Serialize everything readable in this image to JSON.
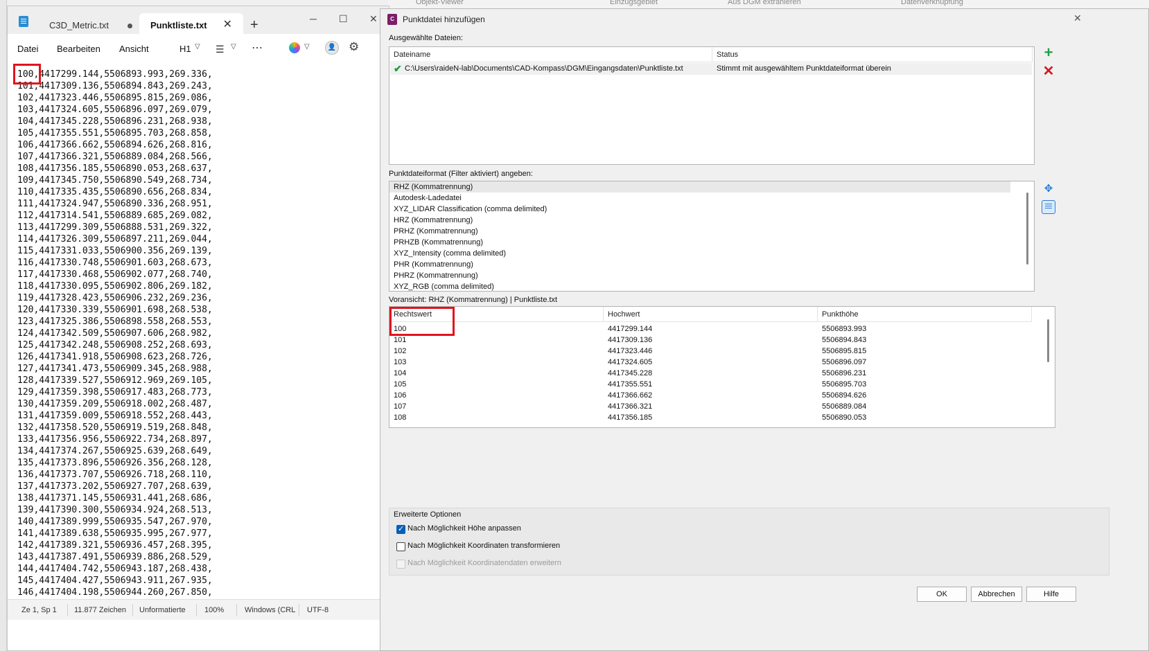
{
  "background_app": {
    "ribbon_fragments": [
      "Objekt-Viewer",
      "Einzugsgebiet",
      "Aus DGM extrahieren",
      "Datenverknüpfung"
    ]
  },
  "notepad": {
    "tabs": [
      {
        "label": "C3D_Metric.txt"
      },
      {
        "label": "Punktliste.txt"
      }
    ],
    "menu": {
      "datei": "Datei",
      "bearbeiten": "Bearbeiten",
      "ansicht": "Ansicht",
      "heading": "H1"
    },
    "lines": [
      "100,4417299.144,5506893.993,269.336,",
      "101,4417309.136,5506894.843,269.243,",
      "102,4417323.446,5506895.815,269.086,",
      "103,4417324.605,5506896.097,269.079,",
      "104,4417345.228,5506896.231,268.938,",
      "105,4417355.551,5506895.703,268.858,",
      "106,4417366.662,5506894.626,268.816,",
      "107,4417366.321,5506889.084,268.566,",
      "108,4417356.185,5506890.053,268.637,",
      "109,4417345.750,5506890.549,268.734,",
      "110,4417335.435,5506890.656,268.834,",
      "111,4417324.947,5506890.336,268.951,",
      "112,4417314.541,5506889.685,269.082,",
      "113,4417299.309,5506888.531,269.322,",
      "114,4417326.309,5506897.211,269.044,",
      "115,4417331.033,5506900.356,269.139,",
      "116,4417330.748,5506901.603,268.673,",
      "117,4417330.468,5506902.077,268.740,",
      "118,4417330.095,5506902.806,269.182,",
      "119,4417328.423,5506906.232,269.236,",
      "120,4417330.339,5506901.698,268.538,",
      "123,4417325.386,5506898.558,268.553,",
      "124,4417342.509,5506907.606,268.982,",
      "125,4417342.248,5506908.252,268.693,",
      "126,4417341.918,5506908.623,268.726,",
      "127,4417341.473,5506909.345,268.988,",
      "128,4417339.527,5506912.969,269.105,",
      "129,4417359.398,5506917.483,268.773,",
      "130,4417359.209,5506918.002,268.487,",
      "131,4417359.009,5506918.552,268.443,",
      "132,4417358.520,5506919.519,268.848,",
      "133,4417356.956,5506922.734,268.897,",
      "134,4417374.267,5506925.639,268.649,",
      "135,4417373.896,5506926.356,268.128,",
      "136,4417373.707,5506926.718,268.110,",
      "137,4417373.202,5506927.707,268.639,",
      "138,4417371.145,5506931.441,268.686,",
      "139,4417390.300,5506934.924,268.513,",
      "140,4417389.999,5506935.547,267.970,",
      "141,4417389.638,5506935.995,267.977,",
      "142,4417389.321,5506936.457,268.395,",
      "143,4417387.491,5506939.886,268.529,",
      "144,4417404.742,5506943.187,268.438,",
      "145,4417404.427,5506943.911,267.935,",
      "146,4417404.198,5506944.260,267.850,"
    ],
    "status": {
      "position": "Ze 1, Sp 1",
      "chars": "11.877 Zeichen",
      "format": "Unformatierte",
      "zoom": "100%",
      "line_ending": "Windows (CRL",
      "encoding": "UTF-8"
    }
  },
  "dialog": {
    "title": "Punktdatei hinzufügen",
    "selected_files_label": "Ausgewählte Dateien:",
    "files_columns": [
      "Dateiname",
      "Status"
    ],
    "files": [
      {
        "name": "C:\\Users\\raideN-lab\\Documents\\CAD-Kompass\\DGM\\Eingangsdaten\\Punktliste.txt",
        "status": "Stimmt mit ausgewähltem Punktdateiformat überein"
      }
    ],
    "format_label": "Punktdateiformat (Filter aktiviert) angeben:",
    "formats": [
      "RHZ (Kommatrennung)",
      "Autodesk-Ladedatei",
      "XYZ_LIDAR Classification (comma delimited)",
      "HRZ (Kommatrennung)",
      "PRHZ (Kommatrennung)",
      "PRHZB (Kommatrennung)",
      "XYZ_Intensity (comma delimited)",
      "PHR (Kommatrennung)",
      "PHRZ (Kommatrennung)",
      "XYZ_RGB (comma delimited)"
    ],
    "preview_label": "Voransicht: RHZ (Kommatrennung) | Punktliste.txt",
    "preview_columns": [
      "Rechtswert",
      "Hochwert",
      "Punkthöhe"
    ],
    "preview_rows": [
      [
        "100",
        "4417299.144",
        "5506893.993"
      ],
      [
        "101",
        "4417309.136",
        "5506894.843"
      ],
      [
        "102",
        "4417323.446",
        "5506895.815"
      ],
      [
        "103",
        "4417324.605",
        "5506896.097"
      ],
      [
        "104",
        "4417345.228",
        "5506896.231"
      ],
      [
        "105",
        "4417355.551",
        "5506895.703"
      ],
      [
        "106",
        "4417366.662",
        "5506894.626"
      ],
      [
        "107",
        "4417366.321",
        "5506889.084"
      ],
      [
        "108",
        "4417356.185",
        "5506890.053"
      ]
    ],
    "options_label": "Erweiterte Optionen",
    "options": [
      {
        "label": "Nach Möglichkeit Höhe anpassen",
        "checked": true,
        "enabled": true
      },
      {
        "label": "Nach Möglichkeit Koordinaten transformieren",
        "checked": false,
        "enabled": true
      },
      {
        "label": "Nach Möglichkeit Koordinatendaten erweitern",
        "checked": false,
        "enabled": false
      }
    ],
    "buttons": {
      "ok": "OK",
      "cancel": "Abbrechen",
      "help": "Hilfe"
    }
  },
  "highlight_color": "#e0141e"
}
